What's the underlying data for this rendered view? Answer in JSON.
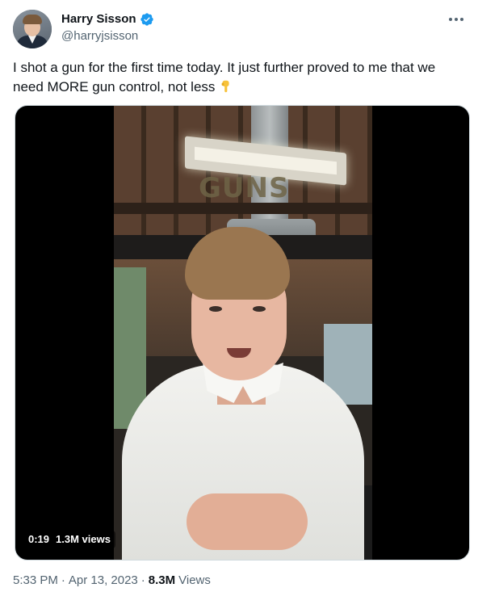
{
  "author": {
    "display_name": "Harry Sisson",
    "handle": "@harryjsisson",
    "verified": true,
    "verified_color": "#1d9bf0"
  },
  "tweet": {
    "text_part1": "I shot a gun for the first time today. It just further proved to me that we need MORE gun control, not less",
    "emoji_icon": "pointing-down-hand"
  },
  "media": {
    "overlay_text": "GUNS",
    "duration": "0:19",
    "views": "1.3M views"
  },
  "footer": {
    "time": "5:33 PM",
    "separator": "·",
    "date": "Apr 13, 2023",
    "views_count": "8.3M",
    "views_label": "Views"
  }
}
